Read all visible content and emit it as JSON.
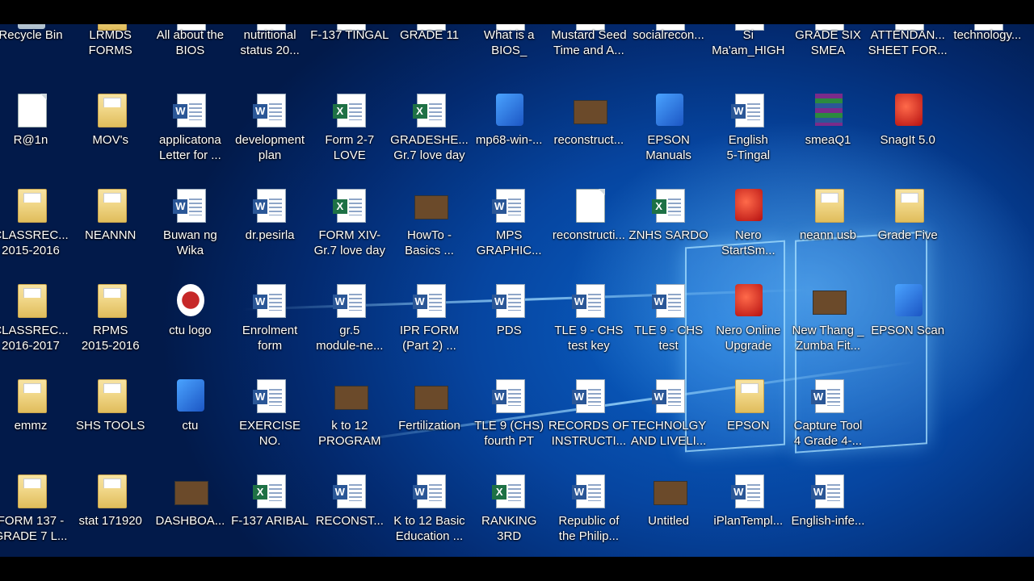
{
  "desktop_icons": [
    {
      "label": "Recycle Bin",
      "type": "recycle"
    },
    {
      "label": "LRMDS\nFORMS",
      "type": "folder"
    },
    {
      "label": "All about the\nBIOS",
      "type": "word"
    },
    {
      "label": "nutritional\nstatus 20...",
      "type": "word"
    },
    {
      "label": "F-137 TINGAL",
      "type": "excel"
    },
    {
      "label": "GRADE 11",
      "type": "excel"
    },
    {
      "label": "What is a\nBIOS_",
      "type": "word"
    },
    {
      "label": "Mustard Seed\nTime and A...",
      "type": "word"
    },
    {
      "label": "socialrecon...",
      "type": "word"
    },
    {
      "label": "Si\nMa'am_HIGH",
      "type": "word"
    },
    {
      "label": "GRADE SIX\nSMEA",
      "type": "excel"
    },
    {
      "label": "ATTENDAN...\nSHEET FOR...",
      "type": "excel"
    },
    {
      "label": "technology...",
      "type": "word"
    },
    {
      "label": "R@1n",
      "type": "doc"
    },
    {
      "label": "MOV's",
      "type": "folder"
    },
    {
      "label": "applicatona\nLetter for ...",
      "type": "word"
    },
    {
      "label": "development\nplan",
      "type": "word"
    },
    {
      "label": "Form 2-7\nLOVE",
      "type": "excel"
    },
    {
      "label": "GRADESHE...\nGr.7 love day",
      "type": "excel"
    },
    {
      "label": "mp68-win-...",
      "type": "app-blue"
    },
    {
      "label": "reconstruct...",
      "type": "pic"
    },
    {
      "label": "EPSON\nManuals",
      "type": "app-blue"
    },
    {
      "label": "English\n5-Tingal",
      "type": "word"
    },
    {
      "label": "smeaQ1",
      "type": "archive"
    },
    {
      "label": "SnagIt 5.0",
      "type": "app-red"
    },
    {
      "label": "CLASSREC...\n2015-2016",
      "type": "folder"
    },
    {
      "label": "NEANNN",
      "type": "folder"
    },
    {
      "label": "Buwan ng\nWika",
      "type": "word"
    },
    {
      "label": "dr.pesirla",
      "type": "word"
    },
    {
      "label": "FORM XIV-\nGr.7 love day",
      "type": "excel"
    },
    {
      "label": "HowTo -\nBasics ...",
      "type": "pic"
    },
    {
      "label": "MPS\nGRAPHIC...",
      "type": "word"
    },
    {
      "label": "reconstructi...",
      "type": "doc"
    },
    {
      "label": "ZNHS SARDO",
      "type": "excel"
    },
    {
      "label": "Nero\nStartSm...",
      "type": "app-red"
    },
    {
      "label": "neann usb",
      "type": "folder"
    },
    {
      "label": "Grade Five",
      "type": "folder"
    },
    {
      "label": "CLASSREC...\n2016-2017",
      "type": "folder"
    },
    {
      "label": "RPMS\n2015-2016",
      "type": "folder"
    },
    {
      "label": "ctu logo",
      "type": "logo"
    },
    {
      "label": "Enrolment\nform",
      "type": "word"
    },
    {
      "label": "gr.5\nmodule-ne...",
      "type": "word"
    },
    {
      "label": "IPR FORM\n(Part 2) ...",
      "type": "word"
    },
    {
      "label": "PDS",
      "type": "word"
    },
    {
      "label": "TLE 9 - CHS\ntest key",
      "type": "word"
    },
    {
      "label": "TLE 9 - CHS\ntest",
      "type": "word"
    },
    {
      "label": "Nero Online\nUpgrade",
      "type": "app-red"
    },
    {
      "label": "New Thang _\nZumba Fit...",
      "type": "pic"
    },
    {
      "label": "EPSON Scan",
      "type": "app-blue"
    },
    {
      "label": "emmz",
      "type": "folder"
    },
    {
      "label": "SHS TOOLS",
      "type": "folder"
    },
    {
      "label": "ctu",
      "type": "app-blue"
    },
    {
      "label": "EXERCISE NO.\n5",
      "type": "word"
    },
    {
      "label": "k to 12\nPROGRAM",
      "type": "pic"
    },
    {
      "label": "Fertilization",
      "type": "pic"
    },
    {
      "label": "TLE 9 (CHS)\nfourth PT",
      "type": "word"
    },
    {
      "label": "RECORDS OF\nINSTRUCTI...",
      "type": "word"
    },
    {
      "label": "TECHNOLGY\nAND LIVELI...",
      "type": "word"
    },
    {
      "label": "EPSON",
      "type": "folder"
    },
    {
      "label": "Capture Tool\n4 Grade 4-...",
      "type": "word"
    },
    {
      "label": "FORM 137 -\nGRADE 7 L...",
      "type": "folder"
    },
    {
      "label": "stat 171920",
      "type": "folder"
    },
    {
      "label": "DASHBOA...",
      "type": "pic"
    },
    {
      "label": "F-137 ARIBAL",
      "type": "excel"
    },
    {
      "label": "RECONST...",
      "type": "word"
    },
    {
      "label": "K to 12 Basic\nEducation ...",
      "type": "word"
    },
    {
      "label": "RANKING\n3RD",
      "type": "excel"
    },
    {
      "label": "Republic of\nthe Philip...",
      "type": "word"
    },
    {
      "label": "Untitled",
      "type": "pic"
    },
    {
      "label": "iPlanTempl...",
      "type": "word"
    },
    {
      "label": "English-infe...",
      "type": "word"
    }
  ],
  "colors": {
    "desktop_bg": "#0645a0",
    "letterbox": "#000000",
    "word_badge": "#2b5797",
    "excel_badge": "#1e7145"
  }
}
